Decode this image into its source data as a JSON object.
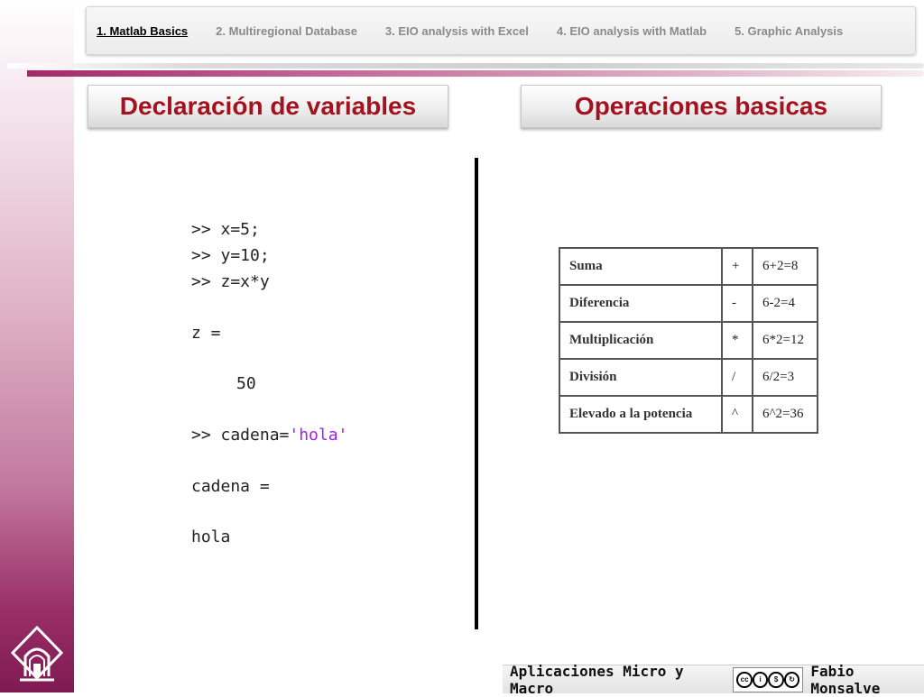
{
  "nav": {
    "items": [
      {
        "label": "1. Matlab Basics",
        "active": true
      },
      {
        "label": "2. Multiregional Database",
        "active": false
      },
      {
        "label": "3. EIO analysis with Excel",
        "active": false
      },
      {
        "label": "4. EIO analysis with Matlab",
        "active": false
      },
      {
        "label": "5. Graphic Analysis",
        "active": false
      }
    ]
  },
  "sections": {
    "left_title": "Declaración de variables",
    "right_title": "Operaciones basicas"
  },
  "code": {
    "lines": [
      ">> x=5;",
      ">> y=10;",
      ">> z=x*y",
      "z =",
      "50",
      ">> cadena=",
      "'hola'",
      "cadena =",
      "hola"
    ]
  },
  "operations": {
    "rows": [
      {
        "name": "Suma",
        "symbol": "+",
        "example": "6+2=8"
      },
      {
        "name": "Diferencia",
        "symbol": "-",
        "example": "6-2=4"
      },
      {
        "name": "Multiplicación",
        "symbol": "*",
        "example": "6*2=12"
      },
      {
        "name": "División",
        "symbol": "/",
        "example": "6/2=3"
      },
      {
        "name": "Elevado a la potencia",
        "symbol": "^",
        "example": "6^2=36"
      }
    ]
  },
  "footer": {
    "left": "Aplicaciones Micro y Macro",
    "right": "Fabio Monsalve",
    "license_icons": [
      "cc",
      "by",
      "nc",
      "sa"
    ]
  }
}
